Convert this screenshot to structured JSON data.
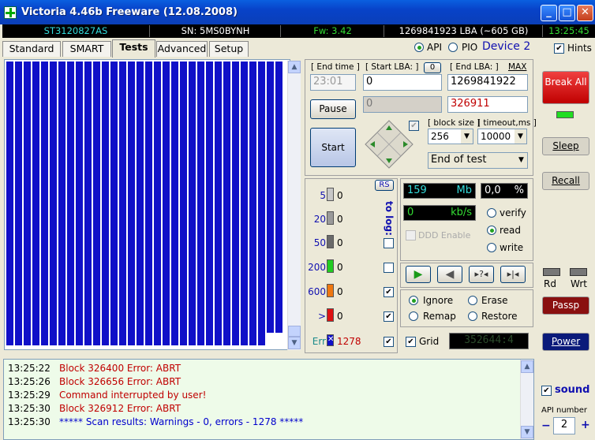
{
  "window": {
    "title": "Victoria 4.46b Freeware (12.08.2008)"
  },
  "infobar": {
    "model": "ST3120827AS",
    "serial": "SN: 5MS0BYNH",
    "firmware": "Fw: 3.42",
    "capacity": "1269841923 LBA (~605 GB)",
    "clock": "13:25:45"
  },
  "mode": {
    "api_label": "API",
    "pio_label": "PIO",
    "device": "Device 2",
    "hints_label": "Hints"
  },
  "tabs": [
    "Standard",
    "SMART",
    "Tests",
    "Advanced",
    "Setup"
  ],
  "test": {
    "end_time_label": "[ End time ]",
    "end_time_value": "23:01",
    "start_lba_label": "[ Start LBA: ]",
    "start_lba_btn": "0",
    "start_lba_value": "0",
    "start_lba_current": "0",
    "end_lba_label": "[ End LBA: ]",
    "end_lba_max": "MAX",
    "end_lba_value": "1269841922",
    "current_lba": "326911",
    "pause_label": "Pause",
    "start_label": "Start",
    "block_size_label": "[ block size ]",
    "block_size_value": "256",
    "timeout_label": "[ timeout,ms ]",
    "timeout_value": "10000",
    "end_action": "End of test"
  },
  "stats": {
    "rs_label": "RS",
    "to_log_label": "to log:",
    "rows": [
      {
        "label": "5",
        "count": "0",
        "color": "#c8c8c8"
      },
      {
        "label": "20",
        "count": "0",
        "color": "#9a9a9a"
      },
      {
        "label": "50",
        "count": "0",
        "color": "#6a6a6a"
      },
      {
        "label": "200",
        "count": "0",
        "color": "#22cc22"
      },
      {
        "label": "600",
        "count": "0",
        "color": "#ee7711"
      },
      {
        "label": ">",
        "count": "0",
        "color": "#dd1111"
      }
    ],
    "err_label": "Err",
    "err_count": "1278"
  },
  "progress": {
    "mb_value": "159",
    "mb_unit": "Mb",
    "percent_value": "0,0",
    "percent_unit": "%",
    "speed_value": "0",
    "speed_unit": "kb/s",
    "ddd_label": "DDD Enable"
  },
  "scan_mode": {
    "verify": "verify",
    "read": "read",
    "write": "write"
  },
  "action_mode": {
    "ignore": "Ignore",
    "erase": "Erase",
    "remap": "Remap",
    "restore": "Restore"
  },
  "grid_label": "Grid",
  "grid_counter": "352644:4",
  "side": {
    "break_all": "Break All",
    "sleep": "Sleep",
    "recall": "Recall",
    "rd": "Rd",
    "wrt": "Wrt",
    "passp": "Passp",
    "power": "Power",
    "sound": "sound",
    "api_number_label": "API number",
    "api_number_value": "2",
    "minus": "−",
    "plus": "+"
  },
  "log": [
    {
      "time": "13:25:22",
      "msg": "Block 326400 Error: ABRT",
      "color": "#c00000"
    },
    {
      "time": "13:25:26",
      "msg": "Block 326656 Error: ABRT",
      "color": "#c00000"
    },
    {
      "time": "13:25:29",
      "msg": "Command interrupted by user!",
      "color": "#c00000"
    },
    {
      "time": "13:25:30",
      "msg": "Block 326912 Error: ABRT",
      "color": "#c00000"
    },
    {
      "time": "13:25:30",
      "msg": "***** Scan results: Warnings - 0, errors - 1278 *****",
      "color": "#0000cc"
    }
  ]
}
